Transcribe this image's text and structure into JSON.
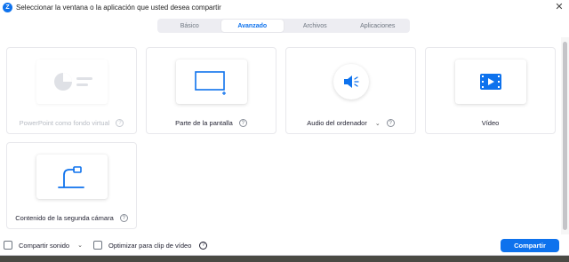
{
  "window": {
    "title": "Seleccionar la ventana o la aplicación que usted desea compartir",
    "logo_letter": "Z",
    "close_glyph": "✕"
  },
  "tabs": [
    {
      "label": "Básico",
      "active": false
    },
    {
      "label": "Avanzado",
      "active": true
    },
    {
      "label": "Archivos",
      "active": false
    },
    {
      "label": "Aplicaciones",
      "active": false
    }
  ],
  "cards": {
    "powerpoint": {
      "label": "PowerPoint como fondo virtual",
      "icon": "powerpoint-background-icon",
      "disabled": true
    },
    "screen_portion": {
      "label": "Parte de la pantalla",
      "icon": "screen-portion-icon"
    },
    "computer_audio": {
      "label": "Audio del ordenador",
      "icon": "speaker-icon",
      "dropdown": "⌄"
    },
    "video": {
      "label": "Vídeo",
      "icon": "film-icon"
    },
    "second_camera": {
      "label": "Contenido de la segunda cámara",
      "icon": "document-camera-icon"
    }
  },
  "help_glyph": "?",
  "bottom": {
    "share_sound_label": "Compartir sonido",
    "share_sound_dropdown": "⌄",
    "optimize_label": "Optimizar para clip de vídeo",
    "share_button": "Compartir"
  },
  "colors": {
    "accent": "#0e72ed",
    "card_border": "#e8e8ec",
    "disabled_text": "#b8bcc4"
  }
}
